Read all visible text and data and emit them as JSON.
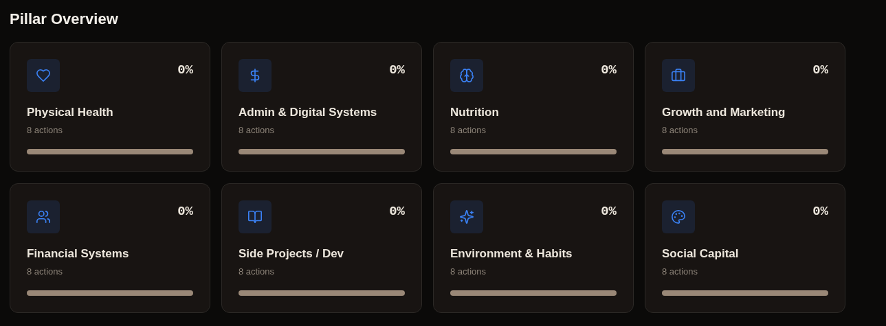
{
  "title": "Pillar Overview",
  "pillars": [
    {
      "kind": "heart",
      "percent": "0%",
      "name": "Physical Health",
      "actions": "8 actions",
      "level": 0
    },
    {
      "kind": "dollar",
      "percent": "0%",
      "name": "Admin & Digital Systems",
      "actions": "8 actions",
      "level": 0
    },
    {
      "kind": "brain",
      "percent": "0%",
      "name": "Nutrition",
      "actions": "8 actions",
      "level": 0
    },
    {
      "kind": "briefcase",
      "percent": "0%",
      "name": "Growth and Marketing",
      "actions": "8 actions",
      "level": 0
    },
    {
      "kind": "users",
      "percent": "0%",
      "name": "Financial Systems",
      "actions": "8 actions",
      "level": 0
    },
    {
      "kind": "book",
      "percent": "0%",
      "name": "Side Projects / Dev",
      "actions": "8 actions",
      "level": 0
    },
    {
      "kind": "sparkles",
      "percent": "0%",
      "name": "Environment & Habits",
      "actions": "8 actions",
      "level": 0
    },
    {
      "kind": "palette",
      "percent": "0%",
      "name": "Social Capital",
      "actions": "8 actions",
      "level": 0
    }
  ]
}
